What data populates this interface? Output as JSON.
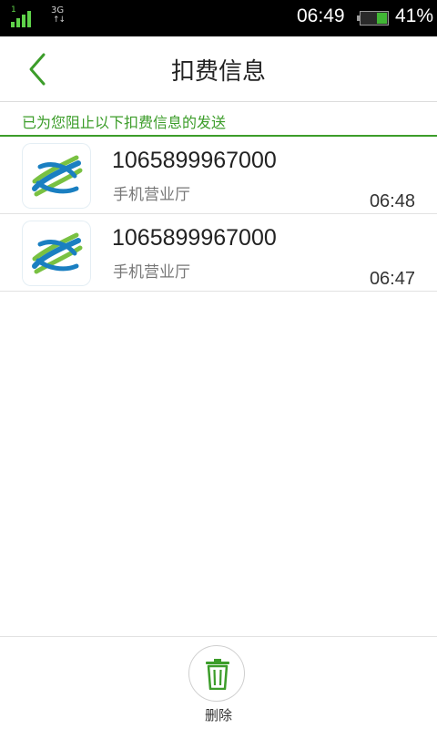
{
  "status_bar": {
    "sim_slot": "1",
    "network_type": "3G",
    "time": "06:49",
    "battery_percent_text": "41%",
    "battery_level": 0.41
  },
  "header": {
    "title": "扣费信息",
    "back_icon": "chevron-left-icon"
  },
  "notice": {
    "text": "已为您阻止以下扣费信息的发送"
  },
  "messages": [
    {
      "number": "1065899967000",
      "sender": "手机营业厅",
      "time": "06:48",
      "icon": "china-mobile-logo"
    },
    {
      "number": "1065899967000",
      "sender": "手机营业厅",
      "time": "06:47",
      "icon": "china-mobile-logo"
    }
  ],
  "bottom_bar": {
    "delete_label": "删除",
    "delete_icon": "trash-icon"
  },
  "colors": {
    "accent": "#3c9d2a",
    "status_bar_bg": "#000000",
    "logo_blue": "#1a7fc1",
    "logo_green": "#79c142"
  }
}
